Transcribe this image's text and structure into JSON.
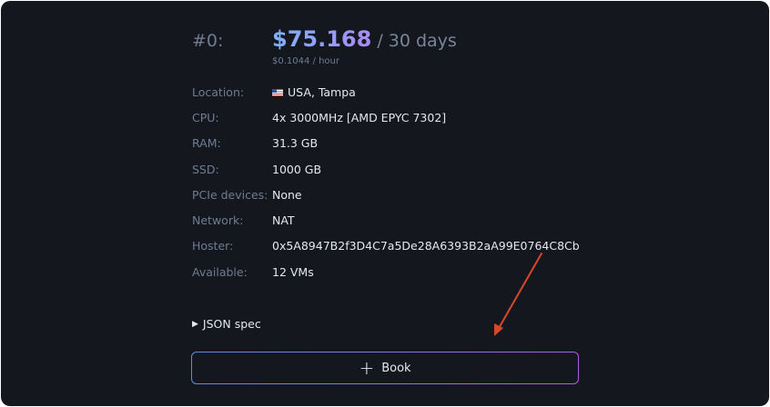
{
  "offer": {
    "index": "#0:",
    "price": "$75.168",
    "period": "/ 30 days",
    "hourly": "$0.1044 / hour"
  },
  "specs": [
    {
      "label": "Location:",
      "value": "USA, Tampa",
      "flag": "us-flag-icon"
    },
    {
      "label": "CPU:",
      "value": "4x 3000MHz [AMD EPYC 7302]"
    },
    {
      "label": "RAM:",
      "value": "31.3 GB"
    },
    {
      "label": "SSD:",
      "value": "1000 GB"
    },
    {
      "label": "PCIe devices:",
      "value": "None"
    },
    {
      "label": "Network:",
      "value": "NAT"
    },
    {
      "label": "Hoster:",
      "value": "0x5A8947B2f3D4C7a5De28A6393B2aA99E0764C8Cb"
    },
    {
      "label": "Available:",
      "value": "12 VMs"
    }
  ],
  "json_spec": {
    "label": "JSON spec",
    "icon": "triangle-right-icon"
  },
  "book_button": {
    "label": "Book",
    "icon": "plus-icon"
  },
  "annotation": {
    "icon": "red-arrow-icon",
    "color": "#d9472b"
  },
  "colors": {
    "background": "#14171d",
    "label": "#6f7c92",
    "value": "#e4e8ef",
    "gradient_start": "#7fb0ff",
    "gradient_end": "#b35ce0"
  }
}
